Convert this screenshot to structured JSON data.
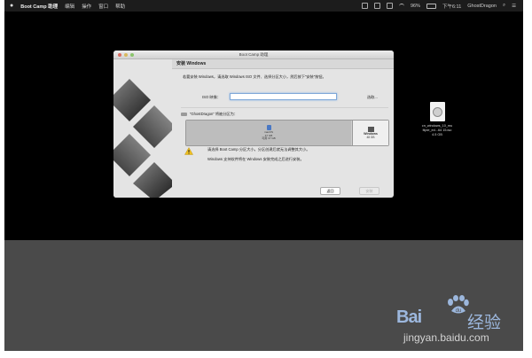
{
  "menubar": {
    "apple": "",
    "app_name": "Boot Camp 助理",
    "menus": [
      "编辑",
      "操作",
      "窗口",
      "帮助"
    ],
    "battery": "96%",
    "clock": "下午6:11",
    "user": "GhostDragon"
  },
  "window": {
    "title": "Boot Camp 助理",
    "heading": "安装 Windows",
    "intro": "若要安装 Windows，请选取 Windows ISO 文件、选择分区大小，然后按下“安装”按钮。",
    "iso_label": "ISO 映像：",
    "iso_value": "",
    "choose_button": "选取...",
    "disk_label": "“GhostDragon” 将被分区为：",
    "mac_partition": {
      "name": "macOS",
      "lines": [
        "47 GB",
        "可用 37 GB"
      ]
    },
    "win_partition": {
      "name": "Windows",
      "size": "48 GB"
    },
    "warning_line1": "请选择 Boot Camp 分区大小。分区创建后就无法调整其大小。",
    "warning_line2": "Windows 支持软件将在 Windows 安装完成之后进行安装。",
    "back_button": "返回",
    "next_button": "安装"
  },
  "desktop_file": {
    "name_lines": [
      "cn_windows_10_mu",
      "ltiple_ed...64 15.iso",
      "4.5 GB"
    ]
  },
  "watermark": {
    "logo": "Bai",
    "logo_tail": "经验",
    "url": "jingyan.baidu.com"
  },
  "colors": {
    "accent": "#4a78c4",
    "warning": "#f0c020",
    "watermark": "#9cb7dd"
  }
}
